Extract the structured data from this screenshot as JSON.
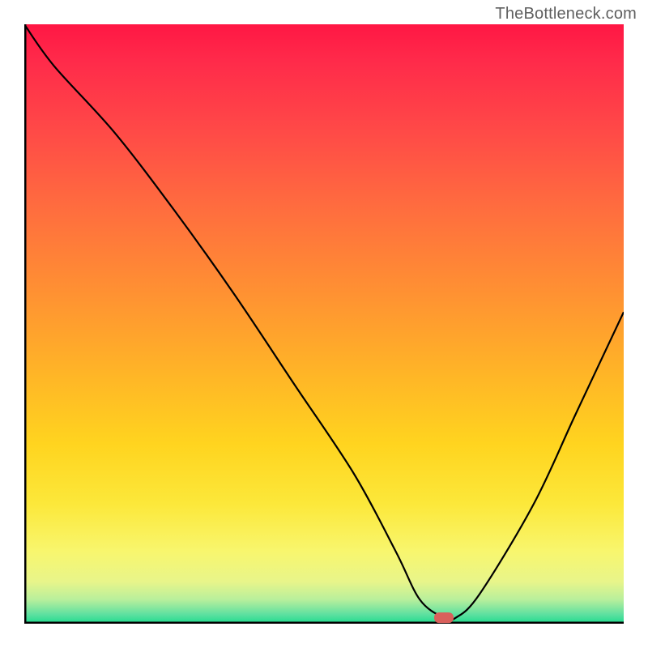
{
  "watermark": "TheBottleneck.com",
  "chart_data": {
    "type": "line",
    "title": "",
    "xlabel": "",
    "ylabel": "",
    "xlim": [
      0,
      100
    ],
    "ylim": [
      0,
      100
    ],
    "series": [
      {
        "name": "bottleneck-curve",
        "x": [
          0,
          5,
          15,
          25,
          35,
          45,
          55,
          62,
          66,
          70,
          72,
          76,
          85,
          92,
          100
        ],
        "y": [
          100,
          93,
          82,
          69,
          55,
          40,
          25,
          12,
          4,
          1,
          1,
          5,
          20,
          35,
          52
        ]
      }
    ],
    "marker": {
      "x": 70,
      "y": 1
    },
    "gradient": {
      "stops": [
        {
          "offset": 0.0,
          "color": "#ff1744"
        },
        {
          "offset": 0.06,
          "color": "#ff2a4a"
        },
        {
          "offset": 0.18,
          "color": "#ff4a47"
        },
        {
          "offset": 0.3,
          "color": "#ff6b3f"
        },
        {
          "offset": 0.44,
          "color": "#ff8f33"
        },
        {
          "offset": 0.58,
          "color": "#ffb427"
        },
        {
          "offset": 0.7,
          "color": "#ffd41f"
        },
        {
          "offset": 0.8,
          "color": "#fce83a"
        },
        {
          "offset": 0.88,
          "color": "#f8f66e"
        },
        {
          "offset": 0.93,
          "color": "#e8f58a"
        },
        {
          "offset": 0.96,
          "color": "#b8ef9c"
        },
        {
          "offset": 0.985,
          "color": "#5ce0a0"
        },
        {
          "offset": 1.0,
          "color": "#1edb8e"
        }
      ]
    },
    "axis_color": "#000000",
    "curve_color": "#000000",
    "marker_color": "#d9605b"
  }
}
